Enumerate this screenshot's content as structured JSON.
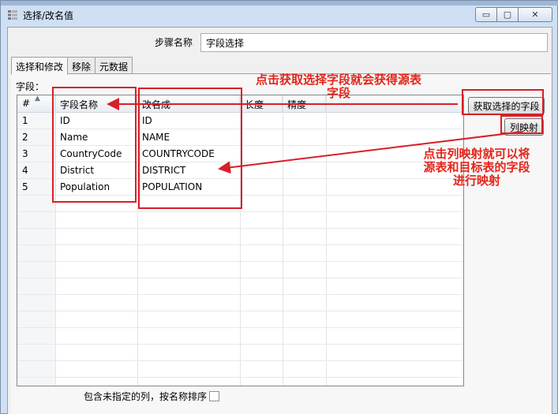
{
  "window": {
    "title": "选择/改名值",
    "controls": {
      "minimize": "▭",
      "maximize": "▢",
      "close": "✕"
    }
  },
  "step": {
    "label": "步骤名称",
    "value": "字段选择"
  },
  "tabs": [
    {
      "label": "选择和修改",
      "active": true
    },
    {
      "label": "移除",
      "active": false
    },
    {
      "label": "元数据",
      "active": false
    }
  ],
  "fields_label": "字段：",
  "grid": {
    "columns": [
      "#",
      "字段名称",
      "改名成",
      "长度",
      "精度"
    ],
    "rows": [
      {
        "num": "1",
        "name": "ID",
        "rename": "ID"
      },
      {
        "num": "2",
        "name": "Name",
        "rename": "NAME"
      },
      {
        "num": "3",
        "name": "CountryCode",
        "rename": "COUNTRYCODE"
      },
      {
        "num": "4",
        "name": "District",
        "rename": "DISTRICT"
      },
      {
        "num": "5",
        "name": "Population",
        "rename": "POPULATION"
      }
    ]
  },
  "buttons": {
    "get_fields": "获取选择的字段",
    "column_mapping": "列映射"
  },
  "bottom_option": {
    "label": "包含未指定的列，按名称排序",
    "checked": false
  },
  "annotations": {
    "top": [
      "点击获取选择字段就会获得源表",
      "字段"
    ],
    "right": [
      "点击列映射就可以将",
      "源表和目标表的字段",
      "进行映射"
    ]
  },
  "colors": {
    "annotation": "#e3241b",
    "box": "#d81f26"
  }
}
